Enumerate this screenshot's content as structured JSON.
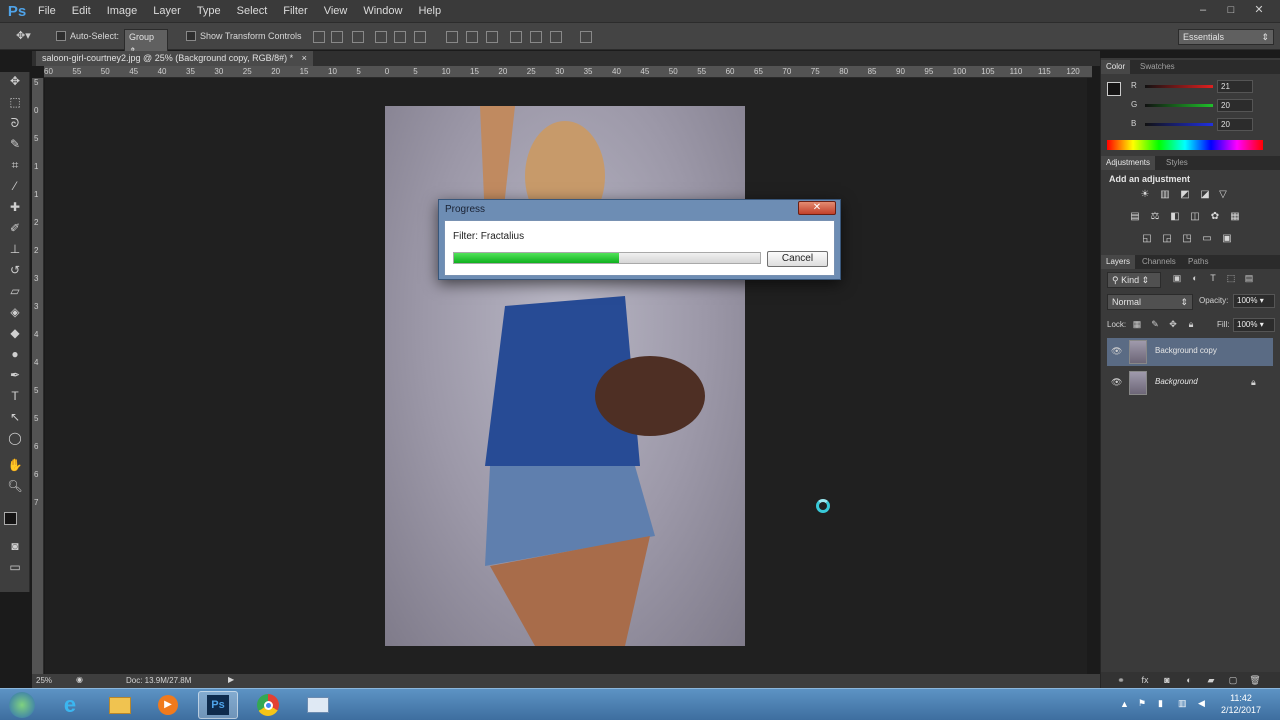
{
  "app": {
    "logo": "Ps",
    "menus": [
      "File",
      "Edit",
      "Image",
      "Layer",
      "Type",
      "Select",
      "Filter",
      "View",
      "Window",
      "Help"
    ],
    "window_controls": [
      "–",
      "□",
      "✕"
    ]
  },
  "options": {
    "auto_select_label": "Auto-Select:",
    "auto_select_value": "Group",
    "show_transform_label": "Show Transform Controls",
    "workspace": "Essentials"
  },
  "document": {
    "tab_title": "saloon-girl-courtney2.jpg @ 25% (Background copy, RGB/8#) *",
    "tab_close": "×",
    "zoom": "25%",
    "doc_info": "Doc: 13.9M/27.8M"
  },
  "ruler": {
    "top_ticks": [
      "60",
      "55",
      "50",
      "45",
      "40",
      "35",
      "30",
      "25",
      "20",
      "15",
      "10",
      "5",
      "0",
      "5",
      "10",
      "15",
      "20",
      "25",
      "30",
      "35",
      "40",
      "45",
      "50",
      "55",
      "60",
      "65",
      "70",
      "75",
      "80",
      "85",
      "90",
      "95",
      "100",
      "105",
      "110",
      "115",
      "120"
    ],
    "left_ticks": [
      "5",
      "0",
      "5",
      "1",
      "1",
      "2",
      "2",
      "3",
      "3",
      "4",
      "4",
      "5",
      "5",
      "6",
      "6",
      "7"
    ]
  },
  "color_panel": {
    "tabs": [
      "Color",
      "Swatches"
    ],
    "r_label": "R",
    "g_label": "G",
    "b_label": "B",
    "r": "21",
    "g": "20",
    "b": "20",
    "foreground": "#151414",
    "background": "#40d0c0"
  },
  "adjustments": {
    "tabs": [
      "Adjustments",
      "Styles"
    ],
    "heading": "Add an adjustment",
    "icons": [
      "brightness-icon",
      "levels-icon",
      "curves-icon",
      "exposure-icon",
      "vibrance-icon",
      "hue-saturation-icon",
      "color-balance-icon",
      "black-white-icon",
      "photo-filter-icon",
      "channel-mixer-icon",
      "color-lookup-icon",
      "invert-icon",
      "posterize-icon",
      "threshold-icon",
      "gradient-map-icon",
      "selective-color-icon"
    ]
  },
  "layers_panel": {
    "tabs": [
      "Layers",
      "Channels",
      "Paths"
    ],
    "kind": "Kind",
    "blend_mode": "Normal",
    "opacity_label": "Opacity:",
    "opacity": "100%",
    "lock_label": "Lock:",
    "fill_label": "Fill:",
    "fill": "100%",
    "layers": [
      {
        "name": "Background copy",
        "selected": true
      },
      {
        "name": "Background",
        "locked": true
      }
    ]
  },
  "dialog": {
    "title": "Progress",
    "close": "✕",
    "filter_text": "Filter: Fractalius",
    "progress": 0.54,
    "cancel": "Cancel"
  },
  "taskbar": {
    "time": "11:42",
    "date": "2/12/2017"
  }
}
